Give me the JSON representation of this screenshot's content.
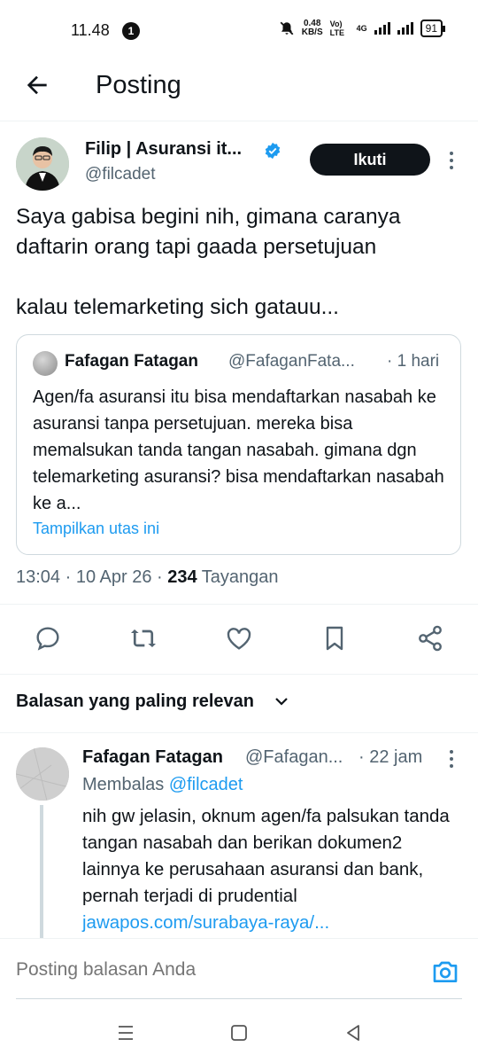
{
  "status_bar": {
    "time": "11.48",
    "notification_count": "1",
    "net_speed_top": "0.48",
    "net_speed_bottom": "KB/S",
    "volte": "Vo) LTE",
    "network": "4G",
    "battery": "91"
  },
  "header": {
    "title": "Posting"
  },
  "tweet": {
    "author_name": "Filip | Asuransi it...",
    "author_handle": "@filcadet",
    "follow_label": "Ikuti",
    "text_line1": "Saya gabisa begini nih, gimana caranya daftarin orang tapi gaada persetujuan",
    "text_line2": "kalau telemarketing sich gatauu...",
    "quote": {
      "name": "Fafagan Fatagan",
      "handle": "@FafaganFata...",
      "time": "· 1 hari",
      "text": "Agen/fa asuransi itu bisa mendaftarkan nasabah ke asuransi tanpa persetujuan. mereka bisa memalsukan tanda tangan nasabah. gimana dgn telemarketing asuransi? bisa mendaftarkan nasabah ke a...",
      "link": "Tampilkan utas ini"
    },
    "meta_time": "13:04 · 10 Apr 26 · ",
    "meta_views": "234",
    "meta_views_label": " Tayangan"
  },
  "actions": [
    "reply-icon",
    "retweet-icon",
    "like-icon",
    "bookmark-icon",
    "share-icon"
  ],
  "replies_sort": "Balasan yang paling relevan",
  "reply": {
    "name": "Fafagan Fatagan",
    "handle": "@Fafagan...",
    "time": "· 22 jam",
    "replying_to_label": "Membalas ",
    "replying_to_handle": "@filcadet",
    "text": "nih gw jelasin, oknum agen/fa palsukan tanda tangan nasabah dan berikan dokumen2 lainnya ke perusahaan asuransi dan bank, pernah terjadi di prudential ",
    "link": "jawapos.com/surabaya-raya/..."
  },
  "compose": {
    "placeholder": "Posting balasan Anda"
  },
  "colors": {
    "accent": "#1d9bf0",
    "text": "#0f1419",
    "secondary": "#536471"
  }
}
